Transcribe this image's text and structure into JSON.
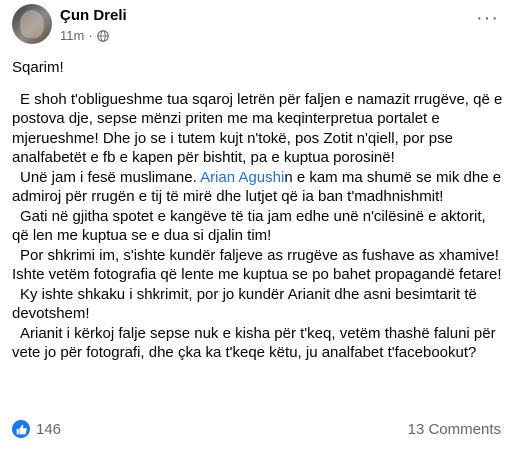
{
  "post": {
    "author": "Çun Dreli",
    "time": "11m",
    "separator": "·",
    "more": "···",
    "greeting": "Sqarim!",
    "p1": "E shoh t'obligueshme tua sqaroj letrën për faljen e namazit rrugëve, që e postova dje, sepse mënzi priten me ma keqinterpretua portalet e mjerueshme! Dhe jo se i tutem kujt n'tokë, pos Zotit n'qiell, por pse analfabetët e fb e kapen për bishtit, pa e kuptua porosinë!",
    "p2_before": "Unë jam i fesë muslimane. ",
    "p2_link": "Arian Agushi",
    "p2_after": "n e kam ma shumë se mik dhe e admiroj për rrugën e tij të mirë dhe lutjet që ia ban t'madhnishmit!",
    "p3": "Gati në gjitha spotet e kangëve të tia jam edhe unë n'cilësinë e aktorit, që len me kuptua se e dua si djalin tim!",
    "p4": "Por shkrimi im, s'ishte kundër faljeve as rrugëve as fushave as xhamive! Ishte vetëm fotografia që lente me kuptua se po bahet propagandë fetare!",
    "p5": "Ky ishte shkaku i shkrimit, por jo kundër Arianit dhe asni besimtarit të devotshem!",
    "p6": "Arianit i kërkoj falje sepse nuk e kisha për t'keq, vetëm thashë faluni për vete jo për fotografi, dhe çka ka t'keqe këtu, ju analfabet t'facebookut?",
    "reactions_count": "146",
    "comments_label": "13 Comments"
  },
  "colors": {
    "link": "#216fdb",
    "like": "#1877f2",
    "meta": "#65676b"
  }
}
